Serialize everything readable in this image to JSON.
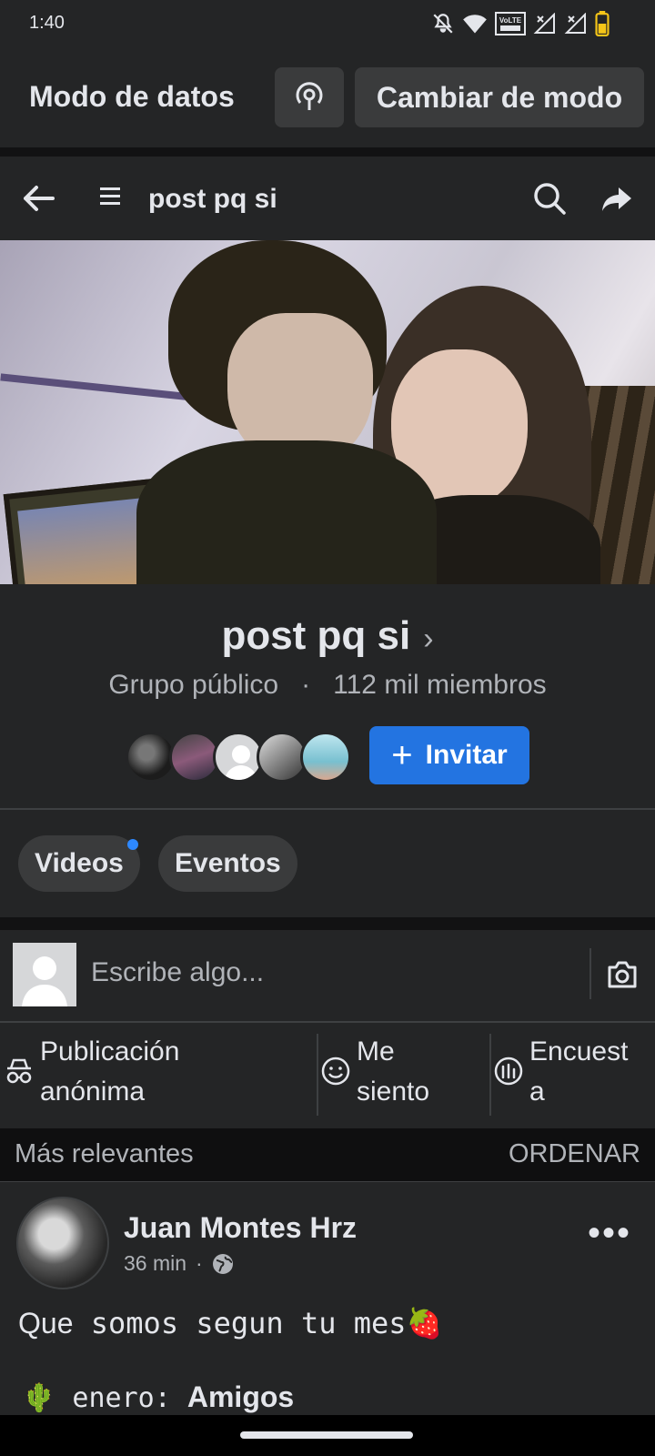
{
  "status_bar": {
    "time": "1:40",
    "volte": "VoLTE",
    "icons": [
      "mute-icon",
      "wifi-icon",
      "volte-icon",
      "signal-icon",
      "signal-icon",
      "battery-icon"
    ]
  },
  "data_mode": {
    "title": "Modo de datos",
    "switch_label": "Cambiar de modo"
  },
  "header": {
    "title": "post pq si"
  },
  "group": {
    "name": "post pq si",
    "chevron": "›",
    "visibility": "Grupo público",
    "separator": "·",
    "members": "112 mil miembros",
    "invite_label": "Invitar",
    "invite_plus": "+"
  },
  "tabs": [
    {
      "label": "Videos",
      "has_dot": true
    },
    {
      "label": "Eventos",
      "has_dot": false
    }
  ],
  "composer": {
    "placeholder": "Escribe algo..."
  },
  "actions": [
    {
      "line1": "Publicación",
      "line2": "anónima",
      "icon": "incognito-icon"
    },
    {
      "line1": "Me",
      "line2": "siento",
      "icon": "smiley-icon"
    },
    {
      "line1": "Encuest",
      "line2": "a",
      "icon": "poll-icon"
    }
  ],
  "feed": {
    "sort_label": "Más relevantes",
    "order_label": "ORDENAR"
  },
  "post": {
    "author": "Juan Montes Hrz",
    "time": "36 min",
    "dot": "·",
    "text_prefix": "Que",
    "text_mono": "somos segun tu mes",
    "emoji": "🍓",
    "line2_emoji": "🌵",
    "line2_prefix": "enero:",
    "line2_value": "Amigos"
  },
  "colors": {
    "background": "#18191a",
    "surface": "#242526",
    "accent": "#2374e1",
    "text": "#e4e6eb",
    "muted": "#b0b3b8"
  }
}
